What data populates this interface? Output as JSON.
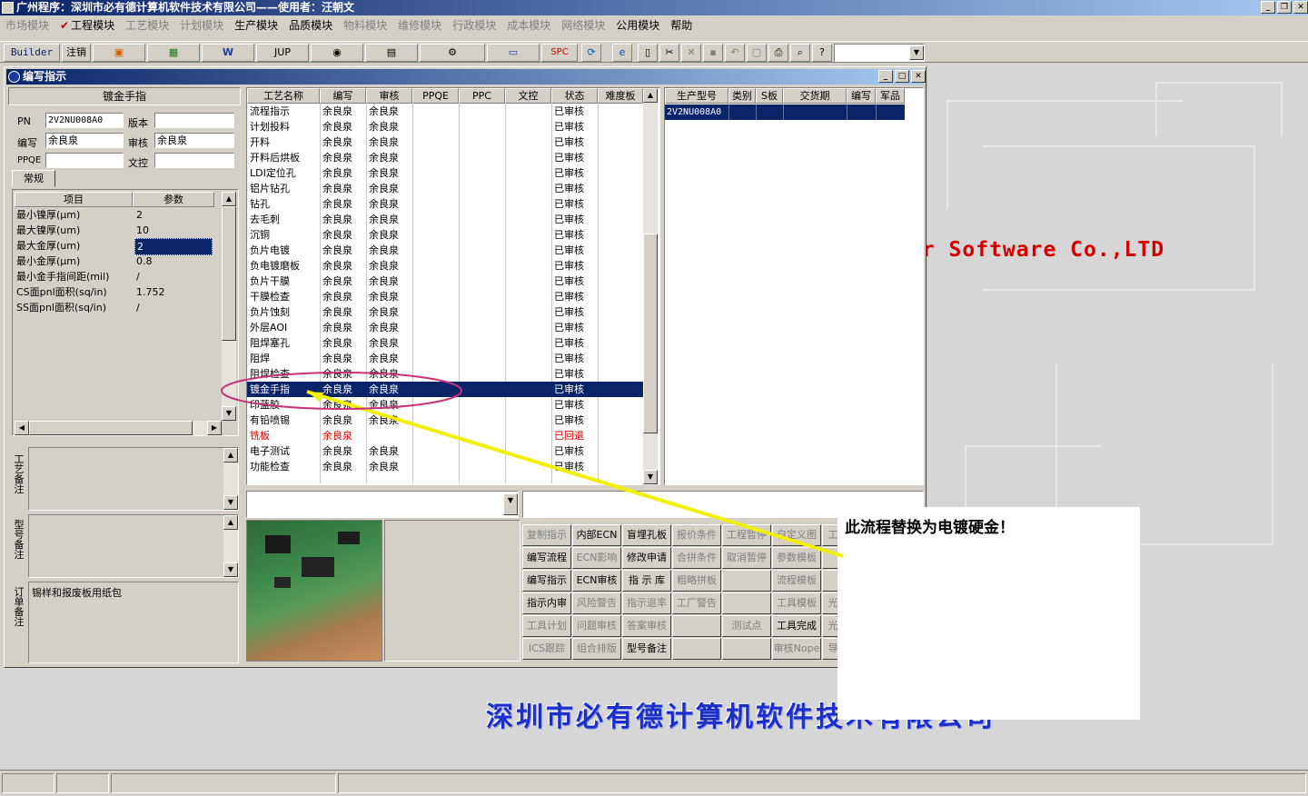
{
  "window": {
    "title": "广州程序：深圳市必有德计算机软件技术有限公司——使用者：汪朝文"
  },
  "menu": [
    {
      "label": "市场模块",
      "enabled": false
    },
    {
      "label": "工程模块",
      "enabled": true,
      "checked": true
    },
    {
      "label": "工艺模块",
      "enabled": false
    },
    {
      "label": "计划模块",
      "enabled": false
    },
    {
      "label": "生产模块",
      "enabled": true
    },
    {
      "label": "品质模块",
      "enabled": true
    },
    {
      "label": "物料模块",
      "enabled": false
    },
    {
      "label": "维修模块",
      "enabled": false
    },
    {
      "label": "行政模块",
      "enabled": false
    },
    {
      "label": "成本模块",
      "enabled": false
    },
    {
      "label": "网络模块",
      "enabled": false
    },
    {
      "label": "公用模块",
      "enabled": true
    },
    {
      "label": "帮助",
      "enabled": true
    }
  ],
  "toolbar": {
    "builder": "Builder",
    "logout": "注销",
    "jup": "JUP",
    "spc": "SPC"
  },
  "background_text": {
    "company_en": "er Software Co.,LTD",
    "company_cn": "深圳市必有德计算机软件技术有限公司"
  },
  "mdi": {
    "title": "编写指示",
    "left": {
      "header": "镀金手指",
      "pn_label": "PN",
      "pn_value": "2V2NU008A0",
      "version_label": "版本",
      "version_value": "",
      "author_label": "编写",
      "author_value": "余良泉",
      "review_label": "审核",
      "review_value": "余良泉",
      "ppqe_label": "PPQE",
      "ppqe_value": "",
      "doc_label": "文控",
      "doc_value": "",
      "tab": "常规",
      "params_headers": [
        "项目",
        "参数"
      ],
      "params": [
        {
          "item": "最小镍厚(μm)",
          "value": "2"
        },
        {
          "item": "最大镍厚(um)",
          "value": "10"
        },
        {
          "item": "最大金厚(um)",
          "value": "2",
          "selected": true
        },
        {
          "item": "最小金厚(μm)",
          "value": "0.8"
        },
        {
          "item": "最小金手指间距(mil)",
          "value": "/"
        },
        {
          "item": "CS面pnl面积(sq/in)",
          "value": "1.752"
        },
        {
          "item": "SS面pnl面积(sq/in)",
          "value": "/"
        }
      ],
      "notes": [
        {
          "label": "工艺备注",
          "text": ""
        },
        {
          "label": "型号备注",
          "text": ""
        },
        {
          "label": "订单备注",
          "text": "锡样和报废板用纸包"
        }
      ]
    },
    "process": {
      "headers": [
        "工艺名称",
        "编写",
        "审核",
        "PPQE",
        "PPC",
        "文控",
        "状态",
        "难度板"
      ],
      "rows": [
        {
          "name": "流程指示",
          "author": "余良泉",
          "reviewer": "余良泉",
          "status": "已审核"
        },
        {
          "name": "计划投料",
          "author": "余良泉",
          "reviewer": "余良泉",
          "status": "已审核"
        },
        {
          "name": "开料",
          "author": "余良泉",
          "reviewer": "余良泉",
          "status": "已审核"
        },
        {
          "name": "开料后烘板",
          "author": "余良泉",
          "reviewer": "余良泉",
          "status": "已审核"
        },
        {
          "name": "LDI定位孔",
          "author": "余良泉",
          "reviewer": "余良泉",
          "status": "已审核"
        },
        {
          "name": "铝片钻孔",
          "author": "余良泉",
          "reviewer": "余良泉",
          "status": "已审核"
        },
        {
          "name": "钻孔",
          "author": "余良泉",
          "reviewer": "余良泉",
          "status": "已审核"
        },
        {
          "name": "去毛刺",
          "author": "余良泉",
          "reviewer": "余良泉",
          "status": "已审核"
        },
        {
          "name": "沉铜",
          "author": "余良泉",
          "reviewer": "余良泉",
          "status": "已审核"
        },
        {
          "name": "负片电镀",
          "author": "余良泉",
          "reviewer": "余良泉",
          "status": "已审核"
        },
        {
          "name": "负电镀磨板",
          "author": "余良泉",
          "reviewer": "余良泉",
          "status": "已审核"
        },
        {
          "name": "负片干膜",
          "author": "余良泉",
          "reviewer": "余良泉",
          "status": "已审核"
        },
        {
          "name": "干膜检查",
          "author": "余良泉",
          "reviewer": "余良泉",
          "status": "已审核"
        },
        {
          "name": "负片蚀刻",
          "author": "余良泉",
          "reviewer": "余良泉",
          "status": "已审核"
        },
        {
          "name": "外层AOI",
          "author": "余良泉",
          "reviewer": "余良泉",
          "status": "已审核"
        },
        {
          "name": "阻焊塞孔",
          "author": "余良泉",
          "reviewer": "余良泉",
          "status": "已审核"
        },
        {
          "name": "阻焊",
          "author": "余良泉",
          "reviewer": "余良泉",
          "status": "已审核"
        },
        {
          "name": "阻焊检查",
          "author": "余良泉",
          "reviewer": "余良泉",
          "status": "已审核"
        },
        {
          "name": "镀金手指",
          "author": "余良泉",
          "reviewer": "余良泉",
          "status": "已审核",
          "selected": true
        },
        {
          "name": "印蓝胶",
          "author": "余良泉",
          "reviewer": "余良泉",
          "status": "已审核"
        },
        {
          "name": "有铅喷锡",
          "author": "余良泉",
          "reviewer": "余良泉",
          "status": "已审核"
        },
        {
          "name": "铣板",
          "author": "余良泉",
          "reviewer": "",
          "status": "已回退",
          "rejected": true
        },
        {
          "name": "电子测试",
          "author": "余良泉",
          "reviewer": "余良泉",
          "status": "已审核"
        },
        {
          "name": "功能检查",
          "author": "余良泉",
          "reviewer": "余良泉",
          "status": "已审核"
        }
      ]
    },
    "models": {
      "headers": [
        "生产型号",
        "类别",
        "S板",
        "交货期",
        "编写",
        "军品"
      ],
      "rows": [
        {
          "model": "2V2NU008A0"
        }
      ]
    },
    "buttons": [
      [
        {
          "label": "复制指示",
          "enabled": false
        },
        {
          "label": "内部ECN",
          "enabled": true
        },
        {
          "label": "盲埋孔板",
          "enabled": true
        },
        {
          "label": "报价条件",
          "enabled": false
        },
        {
          "label": "工程暂停",
          "enabled": false
        },
        {
          "label": "自定义图",
          "enabled": false
        }
      ],
      [
        {
          "label": "编写流程",
          "enabled": true
        },
        {
          "label": "ECN影响",
          "enabled": false
        },
        {
          "label": "修改申请",
          "enabled": true
        },
        {
          "label": "合拼条件",
          "enabled": false
        },
        {
          "label": "取消暂停",
          "enabled": false
        },
        {
          "label": "参数模板",
          "enabled": false
        }
      ],
      [
        {
          "label": "编写指示",
          "enabled": true
        },
        {
          "label": "ECN审核",
          "enabled": true
        },
        {
          "label": "指 示 库",
          "enabled": true
        },
        {
          "label": "粗略拼板",
          "enabled": false
        },
        {
          "label": "",
          "enabled": false
        },
        {
          "label": "流程模板",
          "enabled": false
        }
      ],
      [
        {
          "label": "指示内审",
          "enabled": true
        },
        {
          "label": "风险警告",
          "enabled": false
        },
        {
          "label": "指示退率",
          "enabled": false
        },
        {
          "label": "工厂警告",
          "enabled": false
        },
        {
          "label": "",
          "enabled": false
        },
        {
          "label": "工具模板",
          "enabled": false
        }
      ],
      [
        {
          "label": "工具计划",
          "enabled": false
        },
        {
          "label": "问题审核",
          "enabled": false
        },
        {
          "label": "答案审核",
          "enabled": false
        },
        {
          "label": "",
          "enabled": false
        },
        {
          "label": "测试点",
          "enabled": false
        },
        {
          "label": "工具完成",
          "enabled": true
        }
      ],
      [
        {
          "label": "ICS跟踪",
          "enabled": false
        },
        {
          "label": "组合排版",
          "enabled": false
        },
        {
          "label": "型号备注",
          "enabled": true
        },
        {
          "label": "",
          "enabled": false
        },
        {
          "label": "",
          "enabled": false
        },
        {
          "label": "审核Nope",
          "enabled": false
        }
      ]
    ],
    "buttons_partial": [
      "工",
      "",
      "",
      "光",
      "光",
      "导"
    ]
  },
  "callout": {
    "text": "此流程替换为电镀硬金！"
  },
  "colors": {
    "selection": "#0a246a",
    "rejected": "#e00000",
    "annotation_ellipse": "#c8327a",
    "annotation_arrow": "#f0f000",
    "banner": "#1c2fc8",
    "brand_red": "#d40000"
  }
}
